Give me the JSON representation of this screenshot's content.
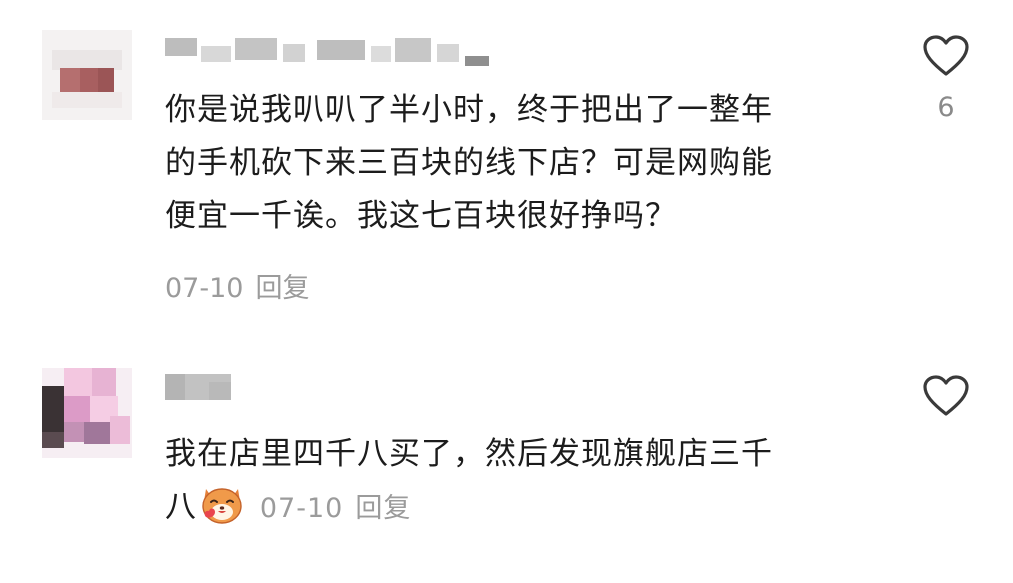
{
  "comments": [
    {
      "content_lines": [
        "你是说我叭叭了半小时，终于把出了一整年",
        "的手机砍下来三百块的线下店？可是网购能",
        "便宜一千诶。我这七百块很好挣吗？"
      ],
      "date": "07-10",
      "reply_label": "回复",
      "like_count": "6",
      "like_icon": "heart-outline-icon",
      "avatar": "pixelated-avatar",
      "username": "pixelated-username"
    },
    {
      "content_lines": [
        "我在店里四千八买了，然后发现旗舰店三千",
        "八"
      ],
      "date": "07-10",
      "reply_label": "回复",
      "like_count": "",
      "like_icon": "heart-outline-icon",
      "emoji": "cat-heart-emoji-icon",
      "avatar": "pixelated-avatar",
      "username": "pixelated-username"
    }
  ]
}
